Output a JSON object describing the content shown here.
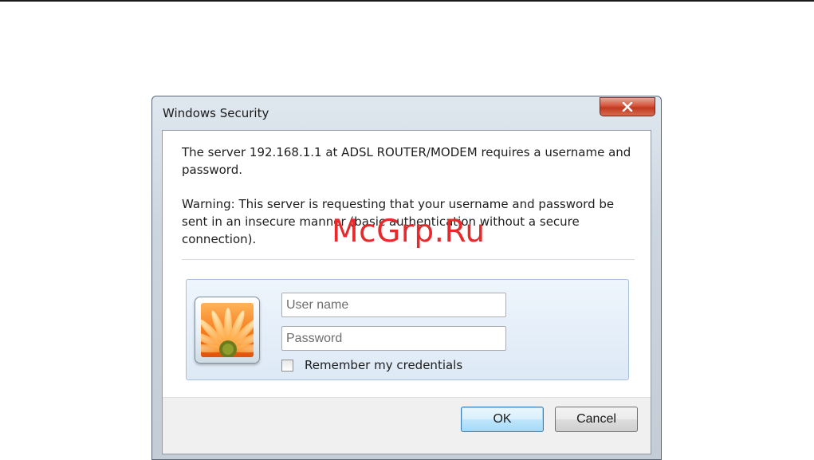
{
  "dialog": {
    "title": "Windows Security",
    "message_lines": [
      "The server 192.168.1.1 at ADSL ROUTER/MODEM requires a username and",
      "password."
    ],
    "warning_lines": [
      "Warning: This server is requesting that your username and password be",
      "sent in an insecure manner (basic authentication without a secure",
      "connection)."
    ],
    "username": {
      "value": "",
      "placeholder": "User name"
    },
    "password": {
      "value": "",
      "placeholder": "Password"
    },
    "remember": {
      "label": "Remember my credentials",
      "checked": false
    },
    "buttons": {
      "ok": "OK",
      "cancel": "Cancel"
    },
    "close_icon": "close-icon",
    "avatar_icon": "flower-user-tile-icon"
  },
  "watermark": "McGrp.Ru",
  "colors": {
    "watermark": "#e8282a",
    "close_button": "#c0391f",
    "credential_panel": "#dde9f6",
    "ok_button_border": "#3c7fb1"
  }
}
